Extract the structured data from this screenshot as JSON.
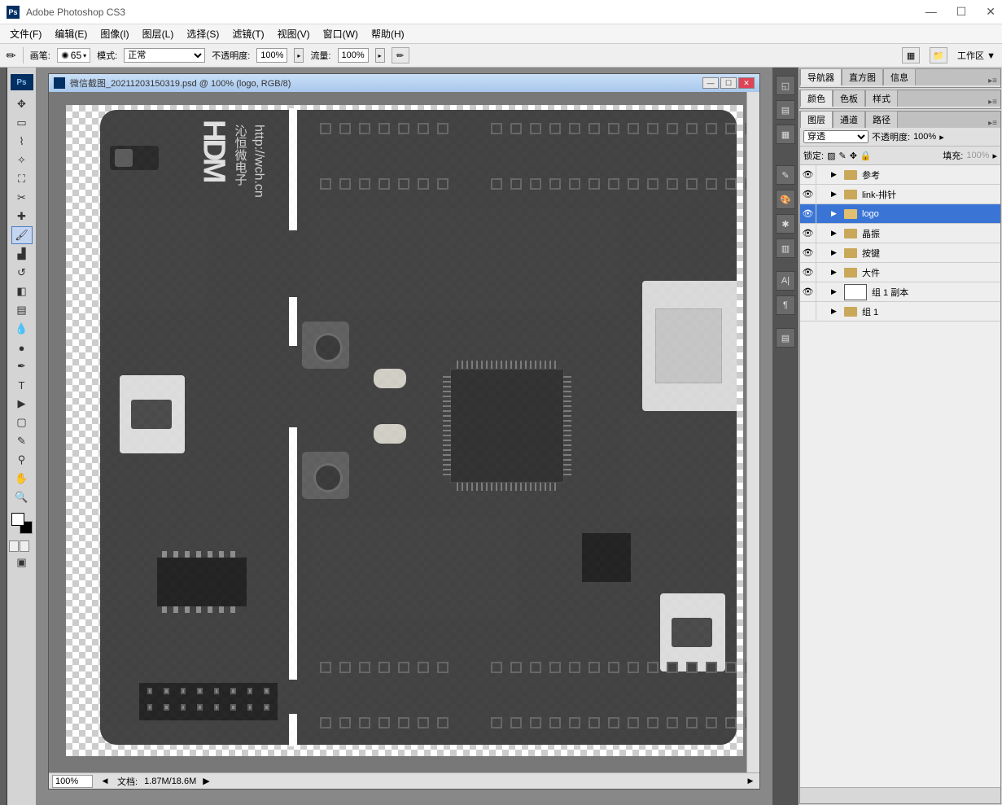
{
  "app": {
    "title": "Adobe Photoshop CS3"
  },
  "menu": [
    "文件(F)",
    "编辑(E)",
    "图像(I)",
    "图层(L)",
    "选择(S)",
    "滤镜(T)",
    "视图(V)",
    "窗口(W)",
    "帮助(H)"
  ],
  "options": {
    "brush_label": "画笔:",
    "brush_size": "65",
    "mode_label": "模式:",
    "mode_value": "正常",
    "opacity_label": "不透明度:",
    "opacity_value": "100%",
    "flow_label": "流量:",
    "flow_value": "100%",
    "workspace_label": "工作区 ▼"
  },
  "doc": {
    "title": "微信截图_20211203150319.psd @ 100% (logo, RGB/8)",
    "zoom": "100%",
    "status_label": "文档:",
    "status_value": "1.87M/18.6M"
  },
  "pcb": {
    "logo": "HDM",
    "sub": "沁恒微电子",
    "url": "http://wch.cn"
  },
  "panel_nav": {
    "tabs": [
      "导航器",
      "直方图",
      "信息"
    ]
  },
  "panel_color": {
    "tabs": [
      "颜色",
      "色板",
      "样式"
    ]
  },
  "panel_layers": {
    "tabs": [
      "图层",
      "通道",
      "路径"
    ],
    "blend_value": "穿透",
    "opacity_label": "不透明度:",
    "opacity_value": "100%",
    "lock_label": "锁定:",
    "fill_label": "填充:",
    "fill_value": "100%",
    "layers": [
      {
        "name": "参考",
        "visible": true,
        "type": "folder"
      },
      {
        "name": "link-排针",
        "visible": true,
        "type": "folder"
      },
      {
        "name": "logo",
        "visible": true,
        "type": "folder",
        "selected": true
      },
      {
        "name": "晶振",
        "visible": true,
        "type": "folder"
      },
      {
        "name": "按键",
        "visible": true,
        "type": "folder"
      },
      {
        "name": "大件",
        "visible": true,
        "type": "folder"
      },
      {
        "name": "组 1 副本",
        "visible": true,
        "type": "group-thumb"
      },
      {
        "name": "组 1",
        "visible": false,
        "type": "folder"
      }
    ]
  }
}
